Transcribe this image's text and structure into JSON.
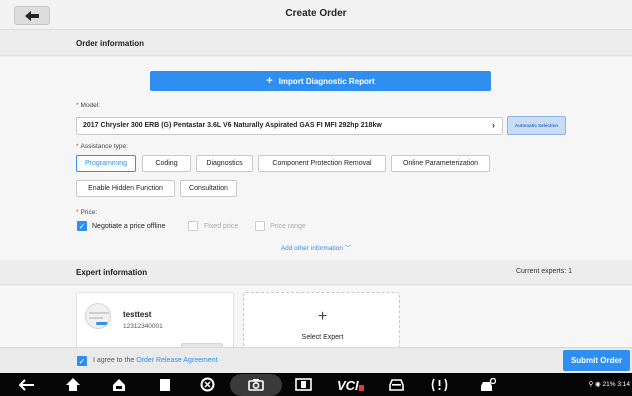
{
  "header": {
    "title": "Create Order"
  },
  "order_section": {
    "title": "Order information"
  },
  "import_button": {
    "label": "Import Diagnostic Report"
  },
  "model": {
    "label": "Model:",
    "value": "2017 Chrysler 300 ERB (G) Pentastar 3.6L V6 Naturally Aspirated GAS FI MFI 292hp 218kw",
    "auto_label": "Automatic Selection"
  },
  "assistance": {
    "label": "Assistance type:",
    "options": [
      "Programming",
      "Coding",
      "Diagnostics",
      "Component Protection Removal",
      "Online Parameterization",
      "Enable Hidden Function",
      "Consultation"
    ],
    "selected": "Programming"
  },
  "price": {
    "label": "Price:",
    "options": [
      "Negotiate a price offline",
      "Fixed price",
      "Price range"
    ],
    "selected": "Negotiate a price offline"
  },
  "add_info": {
    "label": "Add other information"
  },
  "expert_section": {
    "title": "Expert information",
    "current": "Current experts: 1"
  },
  "expert": {
    "name": "testtest",
    "id": "12312340001"
  },
  "select_expert": {
    "label": "Select Expert"
  },
  "footer": {
    "agree_prefix": "I agree to the",
    "agree_link": "Order Release Agreement",
    "submit_label": "Submit Order"
  },
  "status_bar": {
    "text": "21% 3:14"
  },
  "colors": {
    "accent": "#2f8ff0",
    "required": "#e03b3b"
  },
  "icons": [
    "back-arrow-icon",
    "home-icon",
    "recent-apps-icon",
    "screenshot-icon",
    "camera-icon",
    "vci-icon",
    "car-icon",
    "warning-icon",
    "car-service-icon"
  ]
}
